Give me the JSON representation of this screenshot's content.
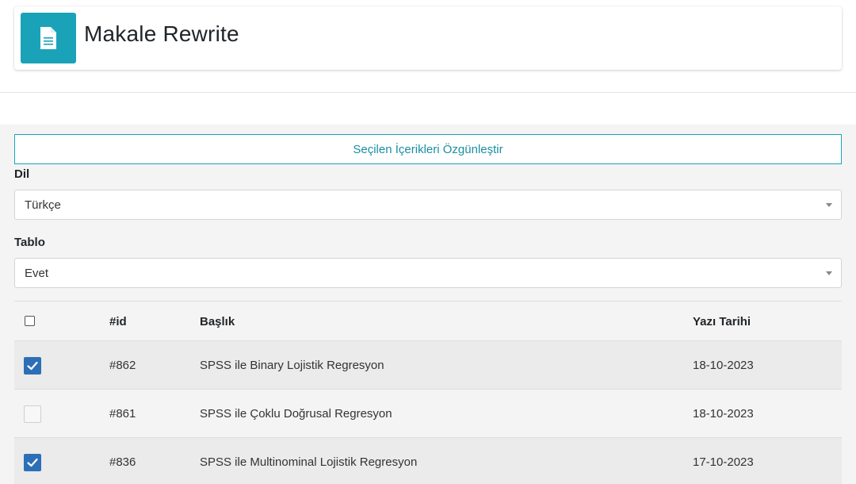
{
  "header": {
    "title": "Makale Rewrite",
    "icon": "document-icon",
    "accent": "#1aa3b8"
  },
  "actions": {
    "rewrite_selected_label": "Seçilen İçerikleri Özgünleştir"
  },
  "form": {
    "language": {
      "label": "Dil",
      "value": "Türkçe"
    },
    "table": {
      "label": "Tablo",
      "value": "Evet"
    }
  },
  "table": {
    "columns": {
      "id": "#id",
      "title": "Başlık",
      "date": "Yazı Tarihi"
    },
    "rows": [
      {
        "id": "#862",
        "title": "SPSS ile Binary Lojistik Regresyon",
        "date": "18-10-2023",
        "checked": true
      },
      {
        "id": "#861",
        "title": "SPSS ile Çoklu Doğrusal Regresyon",
        "date": "18-10-2023",
        "checked": false
      },
      {
        "id": "#836",
        "title": "SPSS ile Multinominal Lojistik Regresyon",
        "date": "17-10-2023",
        "checked": true
      }
    ]
  },
  "colors": {
    "checkbox_checked": "#2d6fb7",
    "button_text": "#1a8fa3"
  }
}
